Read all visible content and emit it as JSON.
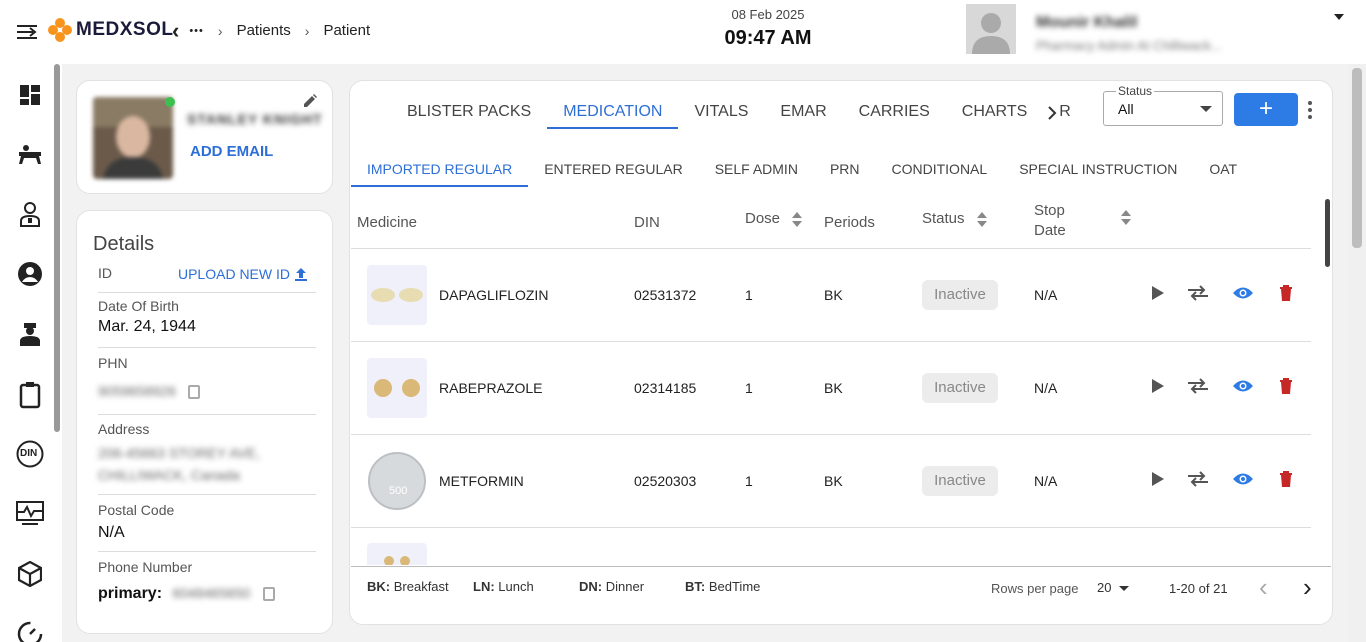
{
  "header": {
    "logo_text": "MEDXSOL",
    "back_chevron": "‹",
    "ellipsis": "•••",
    "breadcrumbs": [
      "Patients",
      "Patient"
    ],
    "breadcrumb_sep": "›",
    "date": "08 Feb 2025",
    "time": "09:47 AM",
    "user_name": "Mounir Khalil",
    "user_role": "Pharmacy Admin At Chilliwack..."
  },
  "sidebar": {
    "icons": [
      "dashboard-icon",
      "bed-icon",
      "doctor-icon",
      "account-icon",
      "nurse-icon",
      "clipboard-icon",
      "din-icon",
      "monitor-heart-icon",
      "package-icon",
      "speed-icon"
    ],
    "din_label": "DIN"
  },
  "profile": {
    "name": "STANLEY KNIGHT",
    "add_email": "ADD EMAIL"
  },
  "details": {
    "title": "Details",
    "id_label": "ID",
    "upload_label": "UPLOAD NEW ID",
    "dob_label": "Date Of Birth",
    "dob_value": "Mar. 24, 1944",
    "phn_label": "PHN",
    "phn_value": "9059658926",
    "address_label": "Address",
    "address_line1": "206-45663 STOREY AVE,",
    "address_line2": "CHILLIWACK, Canada",
    "postal_label": "Postal Code",
    "postal_value": "N/A",
    "phone_label": "Phone Number",
    "phone_prefix": "primary:",
    "phone_value": "6048465650"
  },
  "tabs": [
    "BLISTER PACKS",
    "MEDICATION",
    "VITALS",
    "EMAR",
    "CARRIES",
    "CHARTS",
    "R"
  ],
  "active_tab": "MEDICATION",
  "status_filter": {
    "legend": "Status",
    "value": "All"
  },
  "add_button": "+",
  "subtabs": [
    "IMPORTED REGULAR",
    "ENTERED REGULAR",
    "SELF ADMIN",
    "PRN",
    "CONDITIONAL",
    "SPECIAL INSTRUCTION",
    "OAT"
  ],
  "table": {
    "headers": {
      "medicine": "Medicine",
      "din": "DIN",
      "dose": "Dose",
      "periods": "Periods",
      "status": "Status",
      "stop_date_1": "Stop",
      "stop_date_2": "Date"
    },
    "rows": [
      {
        "medicine": "DAPAGLIFLOZIN",
        "din": "02531372",
        "dose": "1",
        "periods": "BK",
        "status": "Inactive",
        "stop_date": "N/A"
      },
      {
        "medicine": "RABEPRAZOLE",
        "din": "02314185",
        "dose": "1",
        "periods": "BK",
        "status": "Inactive",
        "stop_date": "N/A"
      },
      {
        "medicine": "METFORMIN",
        "din": "02520303",
        "dose": "1",
        "periods": "BK",
        "status": "Inactive",
        "stop_date": "N/A"
      }
    ],
    "pill_imprint": "500"
  },
  "footer": {
    "legend": [
      {
        "code": "BK:",
        "text": "Breakfast"
      },
      {
        "code": "LN:",
        "text": "Lunch"
      },
      {
        "code": "DN:",
        "text": "Dinner"
      },
      {
        "code": "BT:",
        "text": "BedTime"
      }
    ],
    "rows_per_page_label": "Rows per page",
    "rows_per_page_value": "20",
    "range": "1-20 of 21",
    "prev": "‹",
    "next": "›"
  },
  "colors": {
    "accent": "#2d7be5",
    "delete": "#c62828",
    "logo_orange": "#f7941d"
  }
}
